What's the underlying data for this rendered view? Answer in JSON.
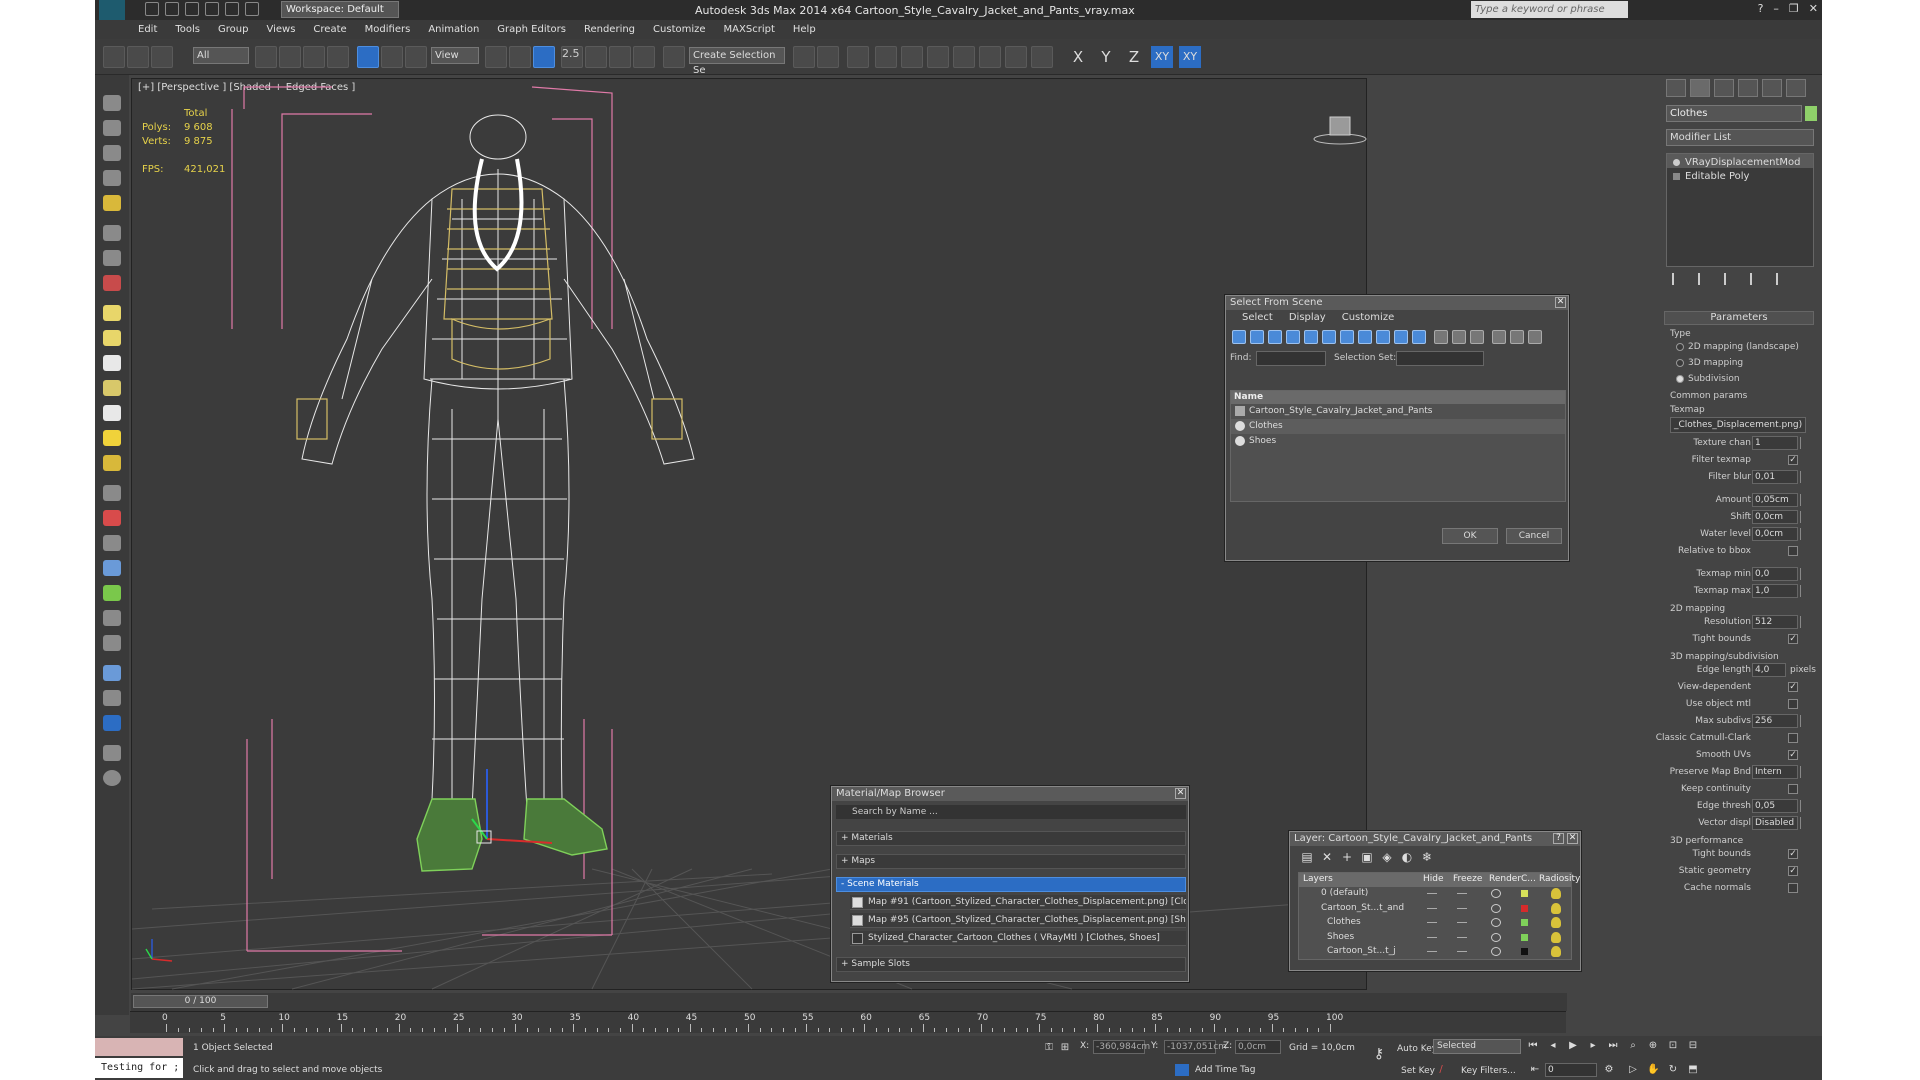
{
  "window": {
    "title": "Autodesk 3ds Max  2014 x64     Cartoon_Style_Cavalry_Jacket_and_Pants_vray.max",
    "workspace": "Workspace: Default",
    "search_placeholder": "Type a keyword or phrase"
  },
  "menu": [
    "Edit",
    "Tools",
    "Group",
    "Views",
    "Create",
    "Modifiers",
    "Animation",
    "Graph Editors",
    "Rendering",
    "Customize",
    "MAXScript",
    "Help"
  ],
  "toolbar": {
    "selection_filter": "All",
    "ref_coord": "View",
    "selection_set_placeholder": "Create Selection Se",
    "axis": [
      "X",
      "Y",
      "Z",
      "XY",
      "XY"
    ],
    "snap_label": "2.5"
  },
  "viewport": {
    "label": "[+] [Perspective ] [Shaded + Edged Faces ]",
    "stats": {
      "total_label": "Total",
      "polys_label": "Polys:",
      "polys": "9 608",
      "verts_label": "Verts:",
      "verts": "9 875",
      "fps_label": "FPS:",
      "fps": "421,021"
    }
  },
  "command_panel": {
    "object_name": "Clothes",
    "object_color": "#8fd16a",
    "modifier_list": "Modifier List",
    "stack": [
      "VRayDisplacementMod",
      "Editable Poly"
    ],
    "parameters_title": "Parameters",
    "type_label": "Type",
    "type_options": [
      "2D mapping (landscape)",
      "3D mapping",
      "Subdivision"
    ],
    "type_selected": 2,
    "common_label": "Common params",
    "texmap_label": "Texmap",
    "texmap_value": "_Clothes_Displacement.png)",
    "rows1": [
      {
        "label": "Texture chan",
        "value": "1",
        "kind": "spin"
      },
      {
        "label": "Filter texmap",
        "value": "✓",
        "kind": "check"
      },
      {
        "label": "Filter blur",
        "value": "0,01",
        "kind": "spin"
      }
    ],
    "rows2": [
      {
        "label": "Amount",
        "value": "0,05cm",
        "kind": "spin"
      },
      {
        "label": "Shift",
        "value": "0,0cm",
        "kind": "spin"
      },
      {
        "label": "Water level",
        "value": "0,0cm",
        "kind": "spin"
      },
      {
        "label": "Relative to bbox",
        "value": "",
        "kind": "check"
      }
    ],
    "rows3": [
      {
        "label": "Texmap min",
        "value": "0,0",
        "kind": "spin"
      },
      {
        "label": "Texmap max",
        "value": "1,0",
        "kind": "spin"
      }
    ],
    "mapping2d_label": "2D mapping",
    "rows4": [
      {
        "label": "Resolution",
        "value": "512",
        "kind": "spin"
      },
      {
        "label": "Tight bounds",
        "value": "✓",
        "kind": "check"
      }
    ],
    "mapping3d_label": "3D mapping/subdivision",
    "rows5": [
      {
        "label": "Edge length",
        "value": "4,0",
        "kind": "spin"
      },
      {
        "label": "View-dependent",
        "value": "✓",
        "kind": "check"
      },
      {
        "label": "Use object mtl",
        "value": "",
        "kind": "check"
      },
      {
        "label": "Max subdivs",
        "value": "256",
        "kind": "spin"
      },
      {
        "label": "Classic Catmull-Clark",
        "value": "",
        "kind": "check"
      },
      {
        "label": "Smooth UVs",
        "value": "✓",
        "kind": "check"
      },
      {
        "label": "Preserve Map Bnd",
        "value": "Intern",
        "kind": "spin"
      },
      {
        "label": "Keep continuity",
        "value": "",
        "kind": "check"
      },
      {
        "label": "Edge thresh",
        "value": "0,05",
        "kind": "spin"
      },
      {
        "label": "Vector displ",
        "value": "Disabled",
        "kind": "spin"
      }
    ],
    "edge_length_unit": "pixels",
    "perf_label": "3D performance",
    "rows6": [
      {
        "label": "Tight bounds",
        "value": "✓",
        "kind": "check"
      },
      {
        "label": "Static geometry",
        "value": "✓",
        "kind": "check"
      },
      {
        "label": "Cache normals",
        "value": "",
        "kind": "check"
      }
    ]
  },
  "select_from_scene": {
    "title": "Select From Scene",
    "menu": [
      "Select",
      "Display",
      "Customize"
    ],
    "find_label": "Find:",
    "selset_label": "Selection Set:",
    "column": "Name",
    "rows": [
      "Cartoon_Style_Cavalry_Jacket_and_Pants",
      "Clothes",
      "Shoes"
    ],
    "ok": "OK",
    "cancel": "Cancel"
  },
  "material_browser": {
    "title": "Material/Map Browser",
    "search": "Search by Name ...",
    "sections": [
      "+ Materials",
      "+ Maps",
      "- Scene Materials",
      "+ Sample Slots"
    ],
    "items": [
      "Map #91 (Cartoon_Stylized_Character_Clothes_Displacement.png) [Clothes]",
      "Map #95 (Cartoon_Stylized_Character_Clothes_Displacement.png) [Shoes]",
      "Stylized_Character_Cartoon_Clothes ( VRayMtl ) [Clothes, Shoes]"
    ]
  },
  "layer_dialog": {
    "title": "Layer: Cartoon_Style_Cavalry_Jacket_and_Pants",
    "columns": [
      "Layers",
      "Hide",
      "Freeze",
      "Render",
      "C...",
      "Radiosity"
    ],
    "rows": [
      {
        "name": "0 (default)",
        "color": "#d6e05a",
        "indent": 0
      },
      {
        "name": "Cartoon_St...t_and",
        "color": "#d62b2b",
        "indent": 0
      },
      {
        "name": "Clothes",
        "color": "#7fd15a",
        "indent": 1
      },
      {
        "name": "Shoes",
        "color": "#7fd15a",
        "indent": 1
      },
      {
        "name": "Cartoon_St...t_j",
        "color": "#111111",
        "indent": 1
      }
    ]
  },
  "timeline": {
    "slider": "0 / 100",
    "ticks": [
      0,
      5,
      10,
      15,
      20,
      25,
      30,
      35,
      40,
      45,
      50,
      55,
      60,
      65,
      70,
      75,
      80,
      85,
      90,
      95,
      100
    ]
  },
  "status": {
    "script": "Testing for ;",
    "selected": "1 Object Selected",
    "hint": "Click and drag to select and move objects",
    "x_label": "X:",
    "x": "-360,984cm",
    "y_label": "Y:",
    "y": "-1037,051cm",
    "z_label": "Z:",
    "z": "0,0cm",
    "grid": "Grid = 10,0cm",
    "add_time_tag": "Add Time Tag",
    "auto_key": "Auto Key",
    "set_key": "Set Key",
    "key_dropdown": "Selected",
    "key_filters": "Key Filters...",
    "frame": "0"
  }
}
